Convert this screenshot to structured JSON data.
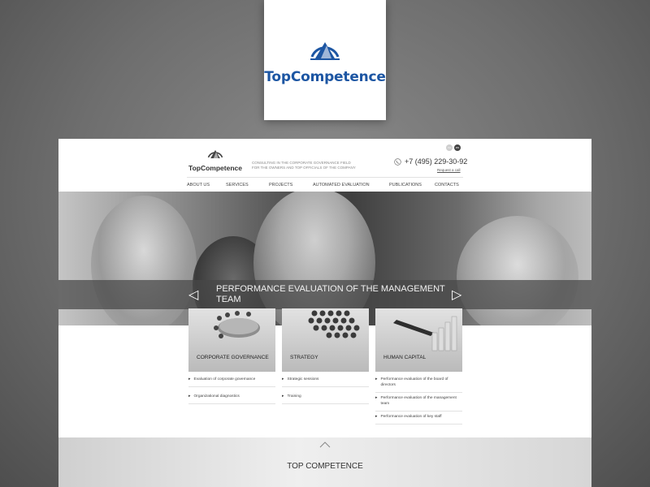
{
  "brand": {
    "name": "TopCompetence",
    "color": "#1d56a3"
  },
  "header": {
    "tagline": "CONSULTING IN THE CORPORATE GOVERNANCE FIELD FOR THE OWNERS AND TOP OFFICIALS OF THE COMPANY",
    "languages": [
      "ru",
      "en"
    ],
    "phone": "+7 (495) 229-30-92",
    "request_call": "Request a call"
  },
  "nav": [
    "ABOUT US",
    "SERVICES",
    "PROJECTS",
    "AUTOMATED EVALUATION",
    "PUBLICATIONS",
    "CONTACTS"
  ],
  "hero": {
    "caption": "PERFORMANCE EVALUATION OF THE MANAGEMENT TEAM"
  },
  "cards": [
    {
      "label": "CORPORATE GOVERNANCE",
      "links": [
        "Evaluation of corporate governance",
        "Organizational diagnostics"
      ]
    },
    {
      "label": "STRATEGY",
      "links": [
        "Strategic sessions",
        "Training"
      ]
    },
    {
      "label": "HUMAN CAPITAL",
      "links": [
        "Performance evaluation of the board of directors",
        "Performance evaluation of the management team",
        "Performance evaluation of key staff"
      ]
    }
  ],
  "footer": {
    "title": "TOP COMPETENCE"
  }
}
